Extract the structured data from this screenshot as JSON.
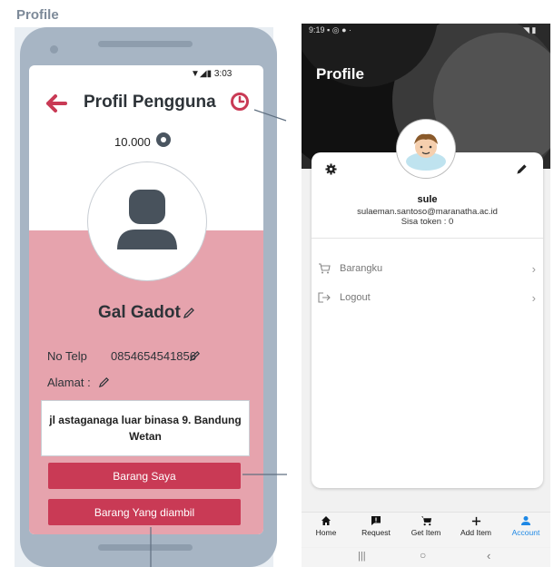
{
  "canvas": {
    "title": "Profile"
  },
  "wireframe": {
    "status_time": "3:03",
    "title": "Profil Pengguna",
    "token_amount": "10.000",
    "user_name": "Gal Gadot",
    "phone_label": "No Telp",
    "phone_value": "0854654541856",
    "address_label": "Alamat :",
    "address_value": "jl astaganaga luar binasa 9. Bandung Wetan",
    "button_my_items": "Barang Saya",
    "button_taken_items": "Barang Yang diambil",
    "colors": {
      "accent": "#c93a55",
      "pink_bg": "#e6a3ad",
      "phone_frame": "#a7b5c4"
    }
  },
  "app": {
    "status_time": "9:19",
    "title": "Profile",
    "user_name": "sule",
    "user_email": "sulaeman.santoso@maranatha.ac.id",
    "token_text": "Sisa token : 0",
    "menu": [
      {
        "label": "Barangku",
        "icon": "cart-icon"
      },
      {
        "label": "Logout",
        "icon": "logout-icon"
      }
    ],
    "nav": [
      {
        "label": "Home",
        "icon": "home-icon"
      },
      {
        "label": "Request",
        "icon": "request-icon"
      },
      {
        "label": "Get Item",
        "icon": "cart-icon"
      },
      {
        "label": "Add Item",
        "icon": "plus-icon"
      },
      {
        "label": "Account",
        "icon": "account-icon",
        "active": true
      }
    ],
    "colors": {
      "active_nav": "#1e88e5"
    }
  }
}
